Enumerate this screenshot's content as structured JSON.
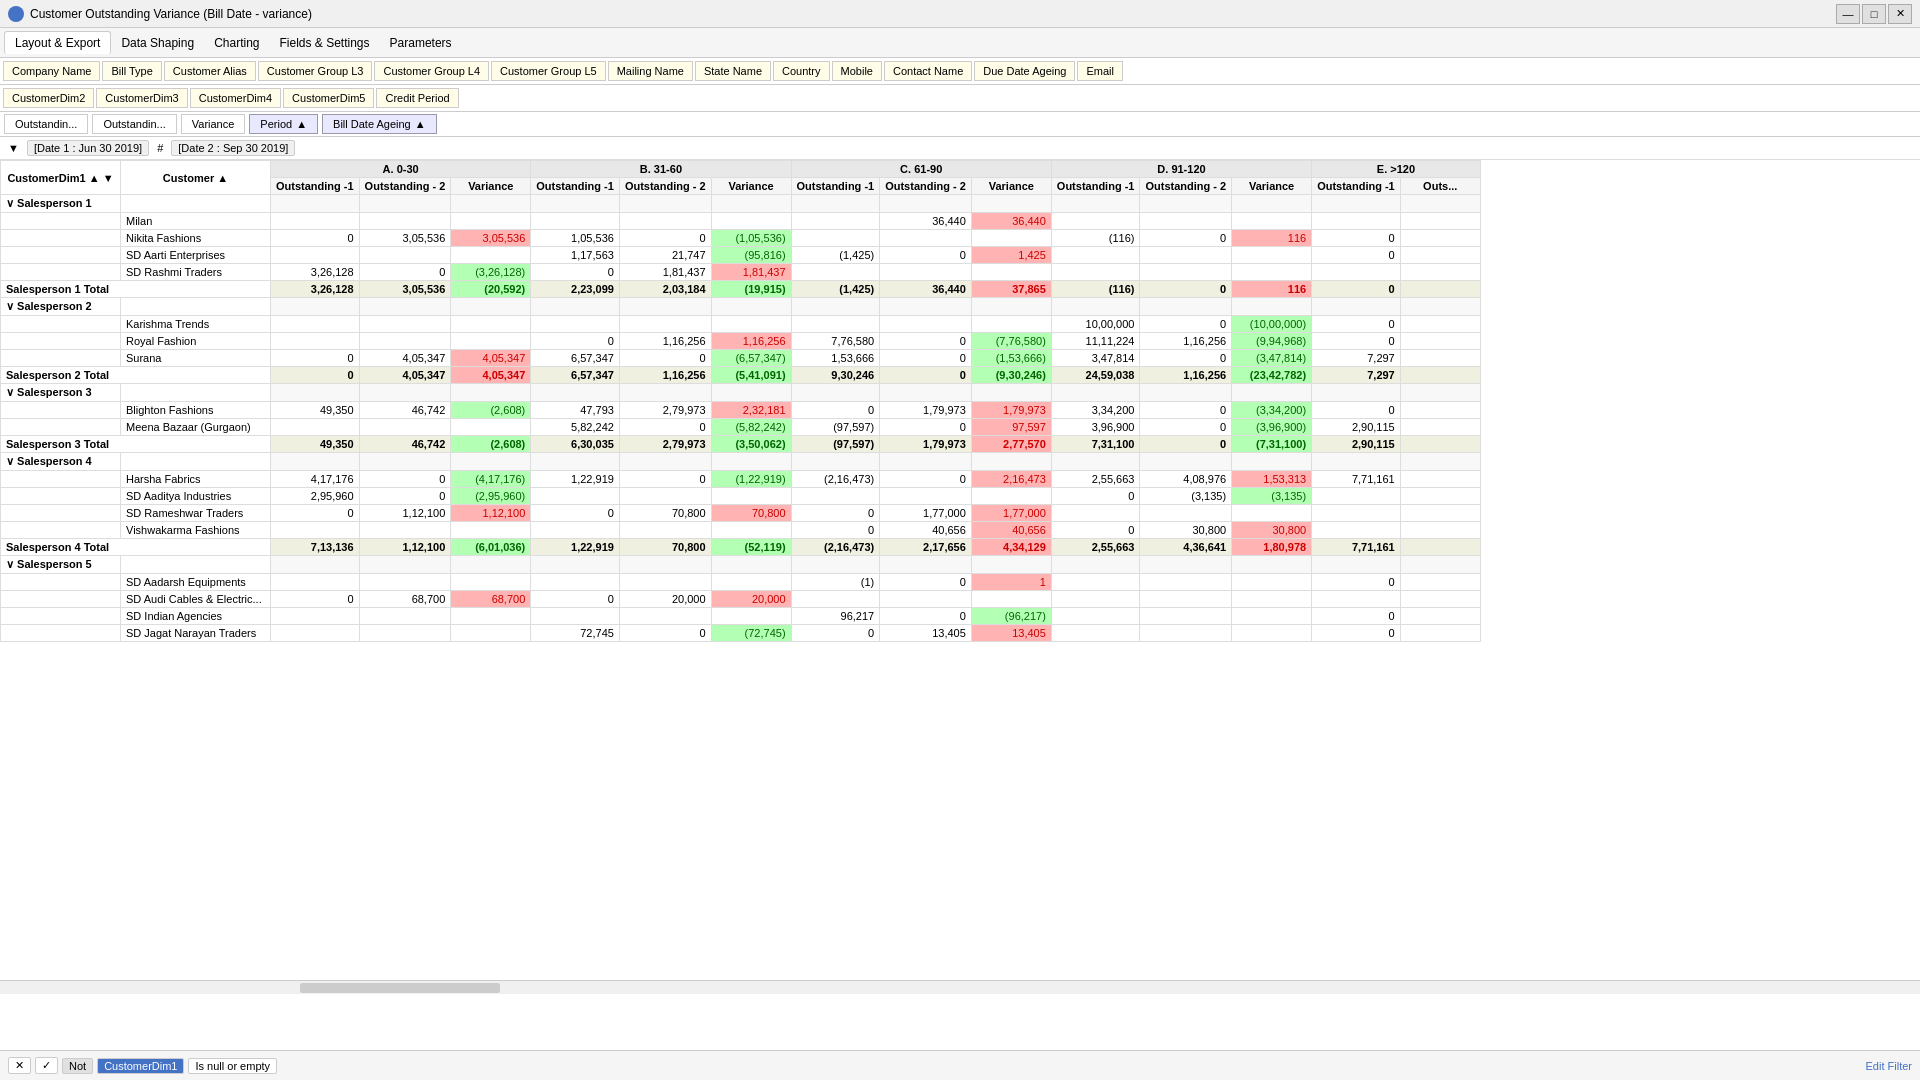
{
  "titleBar": {
    "icon": "chart-icon",
    "title": "Customer Outstanding Variance (Bill Date - variance)",
    "minimize": "—",
    "maximize": "□",
    "close": "✕"
  },
  "menuBar": {
    "items": [
      "Layout & Export",
      "Data Shaping",
      "Charting",
      "Fields & Settings",
      "Parameters"
    ]
  },
  "fieldRowsTop": {
    "row1": [
      "Company Name",
      "Bill Type",
      "Customer Alias",
      "Customer Group L3",
      "Customer Group L4",
      "Customer Group L5",
      "Mailing Name",
      "State Name",
      "Country",
      "Mobile",
      "Contact Name",
      "Due Date Ageing",
      "Email"
    ],
    "row2": [
      "CustomerDim2",
      "CustomerDim3",
      "CustomerDim4",
      "CustomerDim5",
      "Credit Period"
    ]
  },
  "sortButtons": {
    "measures": [
      "Outstandin...",
      "Outstandin...",
      "Variance"
    ],
    "period": "Period",
    "billDate": "Bill Date Ageing"
  },
  "dateFilter": {
    "date1": "[Date 1 : Jun 30 2019]",
    "date2": "[Date 2 : Sep 30 2019]"
  },
  "tableHeaders": {
    "col1": "CustomerDim1",
    "col2": "Customer",
    "groups": [
      {
        "label": "A. 0-30",
        "cols": [
          "Outstanding -1",
          "Outstanding - 2",
          "Variance"
        ]
      },
      {
        "label": "B. 31-60",
        "cols": [
          "Outstanding -1",
          "Outstanding - 2",
          "Variance"
        ]
      },
      {
        "label": "C. 61-90",
        "cols": [
          "Outstanding -1",
          "Outstanding - 2",
          "Variance"
        ]
      },
      {
        "label": "D. 91-120",
        "cols": [
          "Outstanding -1",
          "Outstanding - 2",
          "Variance"
        ]
      },
      {
        "label": "E. >120",
        "cols": [
          "Outstanding -1",
          "Outs..."
        ]
      }
    ]
  },
  "rows": [
    {
      "type": "group",
      "name": "Salesperson 1",
      "customer": ""
    },
    {
      "type": "data",
      "dim": "",
      "customer": "Milan",
      "a1": "",
      "a2": "",
      "av": "",
      "b1": "",
      "b2": "",
      "bv": "",
      "c1": "",
      "c2": "36,440",
      "cv": "36,440",
      "cv_class": "var-red",
      "d1": "",
      "d2": "",
      "dv": "",
      "e1": ""
    },
    {
      "type": "data",
      "dim": "",
      "customer": "Nikita Fashions",
      "a1": "0",
      "a2": "3,05,536",
      "av": "3,05,536",
      "av_class": "var-red",
      "b1": "1,05,536",
      "b2": "0",
      "bv": "(1,05,536)",
      "bv_class": "var-green",
      "c1": "",
      "c2": "",
      "cv": "",
      "d1": "(116)",
      "d2": "0",
      "dv": "116",
      "dv_class": "var-red",
      "e1": "0"
    },
    {
      "type": "data",
      "dim": "",
      "customer": "SD Aarti Enterprises",
      "a1": "",
      "a2": "",
      "av": "",
      "b1": "1,17,563",
      "b2": "21,747",
      "bv": "(95,816)",
      "bv_class": "var-green",
      "c1": "(1,425)",
      "c2": "0",
      "cv": "1,425",
      "cv_class": "var-red",
      "d1": "",
      "d2": "",
      "dv": "",
      "e1": "0"
    },
    {
      "type": "data",
      "dim": "",
      "customer": "SD Rashmi Traders",
      "a1": "3,26,128",
      "a2": "0",
      "av": "(3,26,128)",
      "av_class": "var-green",
      "b1": "0",
      "b2": "1,81,437",
      "bv": "1,81,437",
      "bv_class": "var-red",
      "c1": "",
      "c2": "",
      "cv": "",
      "d1": "",
      "d2": "",
      "dv": "",
      "e1": ""
    },
    {
      "type": "total",
      "name": "Salesperson 1 Total",
      "a1": "3,26,128",
      "a2": "3,05,536",
      "av": "(20,592)",
      "av_class": "var-green",
      "b1": "2,23,099",
      "b2": "2,03,184",
      "bv": "(19,915)",
      "bv_class": "var-green",
      "c1": "(1,425)",
      "c2": "36,440",
      "cv": "37,865",
      "cv_class": "var-red",
      "d1": "(116)",
      "d2": "0",
      "dv": "116",
      "dv_class": "var-red",
      "e1": "0"
    },
    {
      "type": "group",
      "name": "Salesperson 2",
      "customer": ""
    },
    {
      "type": "data",
      "dim": "",
      "customer": "Karishma Trends",
      "a1": "",
      "a2": "",
      "av": "",
      "b1": "",
      "b2": "",
      "bv": "",
      "c1": "",
      "c2": "",
      "cv": "",
      "d1": "10,00,000",
      "d2": "0",
      "dv": "(10,00,000)",
      "dv_class": "var-green",
      "e1": "0"
    },
    {
      "type": "data",
      "dim": "",
      "customer": "Royal Fashion",
      "a1": "",
      "a2": "",
      "av": "",
      "b1": "0",
      "b2": "1,16,256",
      "bv": "1,16,256",
      "bv_class": "var-red",
      "c1": "7,76,580",
      "c2": "0",
      "cv": "(7,76,580)",
      "cv_class": "var-green",
      "d1": "11,11,224",
      "d2": "1,16,256",
      "dv": "(9,94,968)",
      "dv_class": "var-green",
      "e1": "0"
    },
    {
      "type": "data",
      "dim": "",
      "customer": "Surana",
      "a1": "0",
      "a2": "4,05,347",
      "av": "4,05,347",
      "av_class": "var-red",
      "b1": "6,57,347",
      "b2": "0",
      "bv": "(6,57,347)",
      "bv_class": "var-green",
      "c1": "1,53,666",
      "c2": "0",
      "cv": "(1,53,666)",
      "cv_class": "var-green",
      "d1": "3,47,814",
      "d2": "0",
      "dv": "(3,47,814)",
      "dv_class": "var-green",
      "e1": "7,297"
    },
    {
      "type": "total",
      "name": "Salesperson 2 Total",
      "a1": "0",
      "a2": "4,05,347",
      "av": "4,05,347",
      "av_class": "var-red",
      "b1": "6,57,347",
      "b2": "1,16,256",
      "bv": "(5,41,091)",
      "bv_class": "var-green",
      "c1": "9,30,246",
      "c2": "0",
      "cv": "(9,30,246)",
      "cv_class": "var-green",
      "d1": "24,59,038",
      "d2": "1,16,256",
      "dv": "(23,42,782)",
      "dv_class": "var-green",
      "e1": "7,297"
    },
    {
      "type": "group",
      "name": "Salesperson 3",
      "customer": ""
    },
    {
      "type": "data",
      "dim": "",
      "customer": "Blighton Fashions",
      "a1": "49,350",
      "a2": "46,742",
      "av": "(2,608)",
      "av_class": "var-green",
      "b1": "47,793",
      "b2": "2,79,973",
      "bv": "2,32,181",
      "bv_class": "var-red",
      "c1": "0",
      "c2": "1,79,973",
      "cv": "1,79,973",
      "cv_class": "var-red",
      "d1": "3,34,200",
      "d2": "0",
      "dv": "(3,34,200)",
      "dv_class": "var-green",
      "e1": "0"
    },
    {
      "type": "data",
      "dim": "",
      "customer": "Meena Bazaar (Gurgaon)",
      "a1": "",
      "a2": "",
      "av": "",
      "b1": "5,82,242",
      "b2": "0",
      "bv": "(5,82,242)",
      "bv_class": "var-green",
      "c1": "(97,597)",
      "c2": "0",
      "cv": "97,597",
      "cv_class": "var-red",
      "d1": "3,96,900",
      "d2": "0",
      "dv": "(3,96,900)",
      "dv_class": "var-green",
      "e1": "2,90,115"
    },
    {
      "type": "total",
      "name": "Salesperson 3 Total",
      "a1": "49,350",
      "a2": "46,742",
      "av": "(2,608)",
      "av_class": "var-green",
      "b1": "6,30,035",
      "b2": "2,79,973",
      "bv": "(3,50,062)",
      "bv_class": "var-green",
      "c1": "(97,597)",
      "c2": "1,79,973",
      "cv": "2,77,570",
      "cv_class": "var-red",
      "d1": "7,31,100",
      "d2": "0",
      "dv": "(7,31,100)",
      "dv_class": "var-green",
      "e1": "2,90,115"
    },
    {
      "type": "group",
      "name": "Salesperson 4",
      "customer": ""
    },
    {
      "type": "data",
      "dim": "",
      "customer": "Harsha Fabrics",
      "a1": "4,17,176",
      "a2": "0",
      "av": "(4,17,176)",
      "av_class": "var-green",
      "b1": "1,22,919",
      "b2": "0",
      "bv": "(1,22,919)",
      "bv_class": "var-green",
      "c1": "(2,16,473)",
      "c2": "0",
      "cv": "2,16,473",
      "cv_class": "var-red",
      "d1": "2,55,663",
      "d2": "4,08,976",
      "dv": "1,53,313",
      "dv_class": "var-red",
      "e1": "7,71,161"
    },
    {
      "type": "data",
      "dim": "",
      "customer": "SD Aaditya Industries",
      "a1": "2,95,960",
      "a2": "0",
      "av": "(2,95,960)",
      "av_class": "var-green",
      "b1": "",
      "b2": "",
      "bv": "",
      "c1": "",
      "c2": "",
      "cv": "",
      "d1": "0",
      "d2": "(3,135)",
      "dv": "(3,135)",
      "dv_class": "var-green",
      "e1": ""
    },
    {
      "type": "data",
      "dim": "",
      "customer": "SD Rameshwar Traders",
      "a1": "0",
      "a2": "1,12,100",
      "av": "1,12,100",
      "av_class": "var-red",
      "b1": "0",
      "b2": "70,800",
      "bv": "70,800",
      "bv_class": "var-red",
      "c1": "0",
      "c2": "1,77,000",
      "cv": "1,77,000",
      "cv_class": "var-red",
      "d1": "",
      "d2": "",
      "dv": "",
      "e1": ""
    },
    {
      "type": "data",
      "dim": "",
      "customer": "Vishwakarma Fashions",
      "a1": "",
      "a2": "",
      "av": "",
      "b1": "",
      "b2": "",
      "bv": "",
      "c1": "0",
      "c2": "40,656",
      "cv": "40,656",
      "cv_class": "var-red",
      "d1": "0",
      "d2": "30,800",
      "dv": "30,800",
      "dv_class": "var-red",
      "e1": ""
    },
    {
      "type": "total",
      "name": "Salesperson 4 Total",
      "a1": "7,13,136",
      "a2": "1,12,100",
      "av": "(6,01,036)",
      "av_class": "var-green",
      "b1": "1,22,919",
      "b2": "70,800",
      "bv": "(52,119)",
      "bv_class": "var-green",
      "c1": "(2,16,473)",
      "c2": "2,17,656",
      "cv": "4,34,129",
      "cv_class": "var-red",
      "d1": "2,55,663",
      "d2": "4,36,641",
      "dv": "1,80,978",
      "dv_class": "var-red",
      "e1": "7,71,161"
    },
    {
      "type": "group",
      "name": "Salesperson 5",
      "customer": ""
    },
    {
      "type": "data",
      "dim": "",
      "customer": "SD Aadarsh Equipments",
      "a1": "",
      "a2": "",
      "av": "",
      "b1": "",
      "b2": "",
      "bv": "",
      "c1": "(1)",
      "c2": "0",
      "cv": "1",
      "cv_class": "var-red",
      "d1": "",
      "d2": "",
      "dv": "",
      "e1": "0"
    },
    {
      "type": "data",
      "dim": "",
      "customer": "SD Audi Cables & Electric...",
      "a1": "0",
      "a2": "68,700",
      "av": "68,700",
      "av_class": "var-red",
      "b1": "0",
      "b2": "20,000",
      "bv": "20,000",
      "bv_class": "var-red",
      "c1": "",
      "c2": "",
      "cv": "",
      "d1": "",
      "d2": "",
      "dv": "",
      "e1": ""
    },
    {
      "type": "data",
      "dim": "",
      "customer": "SD Indian Agencies",
      "a1": "",
      "a2": "",
      "av": "",
      "b1": "",
      "b2": "",
      "bv": "",
      "c1": "96,217",
      "c2": "0",
      "cv": "(96,217)",
      "cv_class": "var-green",
      "d1": "",
      "d2": "",
      "dv": "",
      "e1": "0"
    },
    {
      "type": "data",
      "dim": "",
      "customer": "SD Jagat Narayan Traders",
      "a1": "",
      "a2": "",
      "av": "",
      "b1": "72,745",
      "b2": "0",
      "bv": "(72,745)",
      "bv_class": "var-green",
      "c1": "0",
      "c2": "13,405",
      "cv": "13,405",
      "cv_class": "var-red",
      "d1": "",
      "d2": "",
      "dv": "",
      "e1": "0"
    }
  ],
  "filterBar": {
    "close": "✕",
    "check": "✓",
    "not": "Not",
    "field": "CustomerDim1",
    "condition": "Is null or empty",
    "editFilter": "Edit Filter"
  }
}
